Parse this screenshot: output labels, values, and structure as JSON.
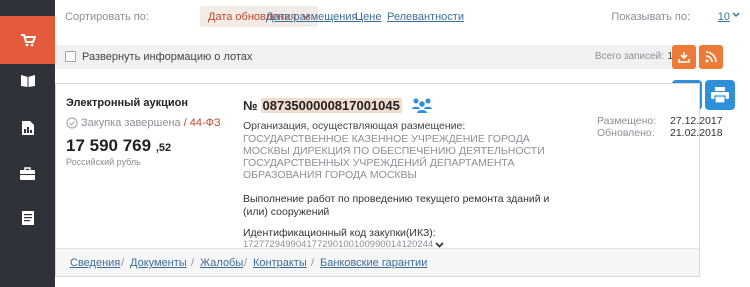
{
  "sidebar": {
    "items": [
      {
        "icon": "cart-icon"
      },
      {
        "icon": "book-icon"
      },
      {
        "icon": "document-chart-icon"
      },
      {
        "icon": "briefcase-icon"
      },
      {
        "icon": "document-list-icon"
      }
    ],
    "active_color": "#e55a3a"
  },
  "sort": {
    "label": "Сортировать по:",
    "active": "Дата обновления",
    "links": [
      "Дата размещения",
      "Цене",
      "Релевантности"
    ],
    "per_page_label": "Показывать по:",
    "per_page_value": "10"
  },
  "expand": {
    "label": "Развернуть информацию о лотах",
    "total_label": "Всего записей:",
    "total_value": "1"
  },
  "card": {
    "auction_type": "Электронный аукцион",
    "status": "Закупка завершена",
    "law": "/ 44-ФЗ",
    "price_main": "17 590 769",
    "price_kop": ",52",
    "currency": "Российский рубль",
    "number_prefix": "№",
    "number": "0873500000817001045",
    "org_label": "Организация, осуществляющая размещение:",
    "org_name": "ГОСУДАРСТВЕННОЕ КАЗЕННОЕ УЧРЕЖДЕНИЕ ГОРОДА МОСКВЫ ДИРЕКЦИЯ ПО ОБЕСПЕЧЕНИЮ ДЕЯТЕЛЬНОСТИ ГОСУДАРСТВЕННЫХ УЧРЕЖДЕНИЙ ДЕПАРТАМЕНТА ОБРАЗОВАНИЯ ГОРОДА МОСКВЫ",
    "purchase_object": "Выполнение работ по проведению текущего ремонта зданий и (или) сооружений",
    "ikz_label": "Идентификационный код закупки(ИКЗ):",
    "ikz_value": "172772949904177290100100990014120244",
    "posted_label": "Размещено:",
    "posted_value": "27.12.2017",
    "updated_label": "Обновлено:",
    "updated_value": "21.02.2018",
    "tabs": [
      "Сведения",
      "Документы",
      "Жалобы",
      "Контракты",
      "Банковские гарантии"
    ]
  },
  "colors": {
    "accent_orange": "#ee7a3a",
    "accent_blue": "#2f8fd8",
    "link": "#3c6d9d"
  }
}
